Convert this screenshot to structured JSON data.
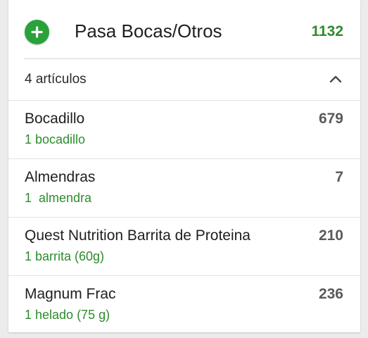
{
  "colors": {
    "accent": "#2aa23a",
    "total_text": "#2e8b2e",
    "serving_text": "#2e8b2e",
    "calorie_text": "#5a5a5a"
  },
  "category": {
    "add_icon": "plus-icon",
    "title": "Pasa Bocas/Otros",
    "total": "1132"
  },
  "summary": {
    "label": "4 artículos",
    "toggle_icon": "chevron-up-icon"
  },
  "items": [
    {
      "name": "Bocadillo",
      "serving": "1 bocadillo",
      "calories": "679"
    },
    {
      "name": "Almendras",
      "serving": "1  almendra",
      "calories": "7"
    },
    {
      "name": "Quest Nutrition Barrita de Proteina",
      "serving": "1 barrita (60g)",
      "calories": "210"
    },
    {
      "name": "Magnum Frac",
      "serving": "1 helado (75 g)",
      "calories": "236"
    }
  ]
}
